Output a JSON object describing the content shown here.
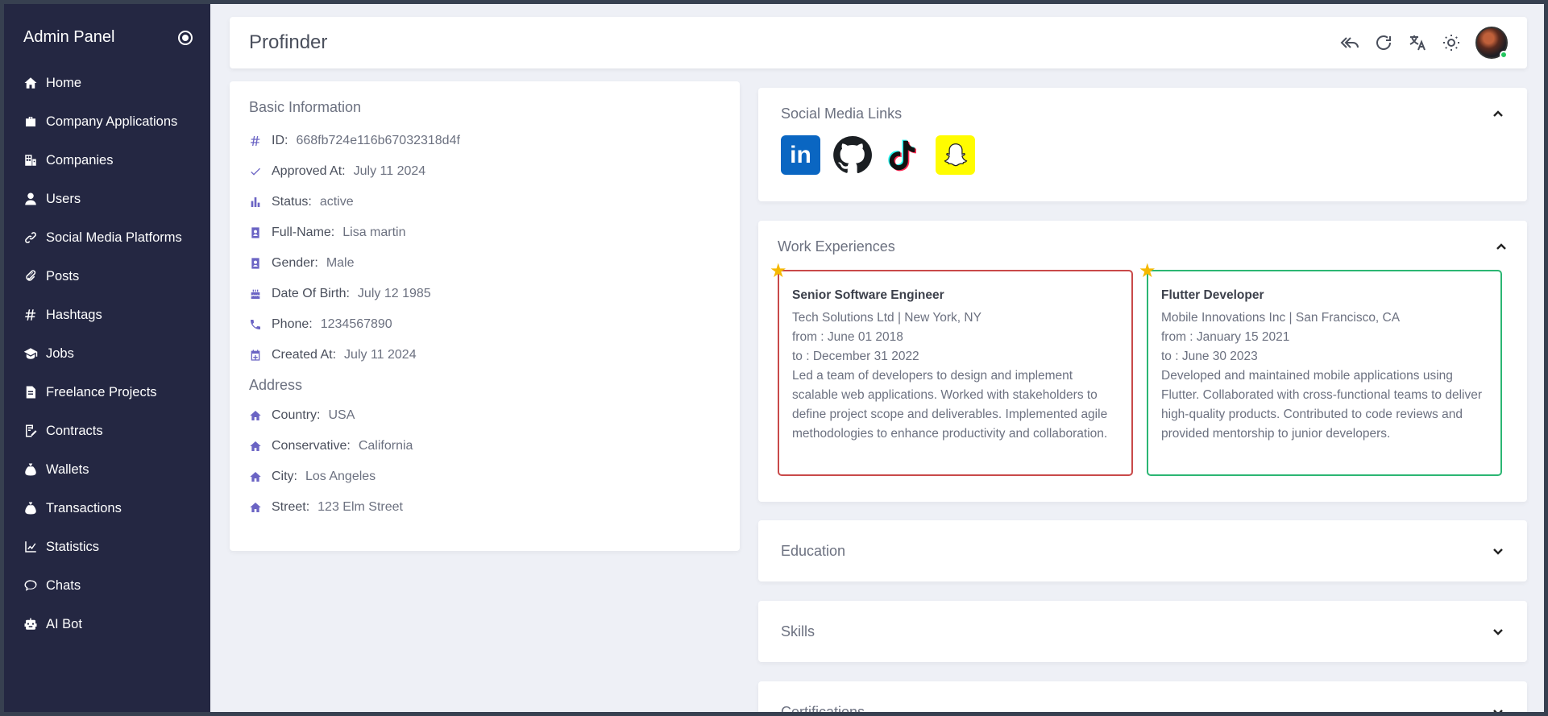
{
  "sidebar": {
    "title": "Admin Panel",
    "items": [
      {
        "label": "Home",
        "icon": "home-icon"
      },
      {
        "label": "Company Applications",
        "icon": "briefcase-icon"
      },
      {
        "label": "Companies",
        "icon": "building-icon"
      },
      {
        "label": "Users",
        "icon": "user-icon"
      },
      {
        "label": "Social Media Platforms",
        "icon": "link-icon"
      },
      {
        "label": "Posts",
        "icon": "paperclip-icon"
      },
      {
        "label": "Hashtags",
        "icon": "hashtag-icon"
      },
      {
        "label": "Jobs",
        "icon": "graduation-cap-icon"
      },
      {
        "label": "Freelance Projects",
        "icon": "document-icon"
      },
      {
        "label": "Contracts",
        "icon": "contract-icon"
      },
      {
        "label": "Wallets",
        "icon": "money-bag-icon"
      },
      {
        "label": "Transactions",
        "icon": "money-bag-icon"
      },
      {
        "label": "Statistics",
        "icon": "line-chart-icon"
      },
      {
        "label": "Chats",
        "icon": "chat-icon"
      },
      {
        "label": "AI Bot",
        "icon": "robot-icon"
      }
    ]
  },
  "topbar": {
    "brand": "Profinder"
  },
  "basic": {
    "title": "Basic Information",
    "rows": [
      {
        "label": "ID:",
        "value": "668fb724e116b67032318d4f"
      },
      {
        "label": "Approved At:",
        "value": "July 11 2024"
      },
      {
        "label": "Status:",
        "value": "active"
      },
      {
        "label": "Full-Name:",
        "value": "Lisa martin"
      },
      {
        "label": "Gender:",
        "value": "Male"
      },
      {
        "label": "Date Of Birth:",
        "value": "July 12 1985"
      },
      {
        "label": "Phone:",
        "value": "1234567890"
      },
      {
        "label": "Created At:",
        "value": "July 11 2024"
      }
    ],
    "address_title": "Address",
    "address": [
      {
        "label": "Country:",
        "value": "USA"
      },
      {
        "label": "Conservative:",
        "value": "California"
      },
      {
        "label": "City:",
        "value": "Los Angeles"
      },
      {
        "label": "Street:",
        "value": "123 Elm Street"
      }
    ]
  },
  "social": {
    "title": "Social Media Links",
    "linkedin_text": "in"
  },
  "work": {
    "title": "Work Experiences",
    "items": [
      {
        "title": "Senior Software Engineer",
        "company": "Tech Solutions Ltd | New York, NY",
        "from": "from : June 01 2018",
        "to": "to : December 31 2022",
        "description": "Led a team of developers to design and implement scalable web applications. Worked with stakeholders to define project scope and deliverables. Implemented agile methodologies to enhance productivity and collaboration."
      },
      {
        "title": "Flutter Developer",
        "company": "Mobile Innovations Inc | San Francisco, CA",
        "from": "from : January 15 2021",
        "to": "to : June 30 2023",
        "description": "Developed and maintained mobile applications using Flutter. Collaborated with cross-functional teams to deliver high-quality products. Contributed to code reviews and provided mentorship to junior developers."
      }
    ]
  },
  "education": {
    "title": "Education"
  },
  "skills": {
    "title": "Skills"
  },
  "certifications": {
    "title": "Certifications"
  },
  "colors": {
    "sidebar_bg": "#242742",
    "accent": "#6b64c4",
    "red_border": "#c94949",
    "green_border": "#2bb673"
  }
}
